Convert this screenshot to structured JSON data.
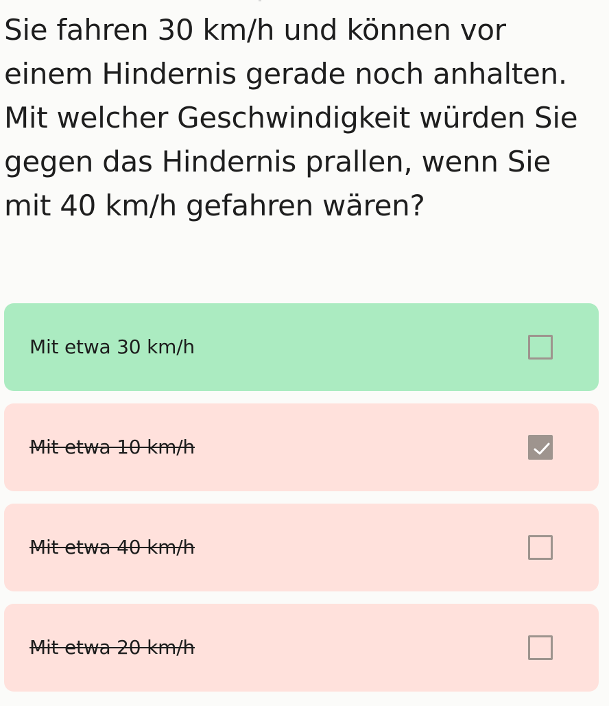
{
  "question": {
    "text": "Sie fahren 30 km/h und können vor einem Hindernis gerade noch anhalten. Mit welcher Geschwindigkeit würden Sie gegen das Hindernis prallen, wenn Sie mit 40 km/h gefahren wären?"
  },
  "answers": [
    {
      "label": "Mit etwa 30 km/h",
      "state": "correct",
      "checked": false
    },
    {
      "label": "Mit etwa 10 km/h",
      "state": "wrong",
      "checked": true
    },
    {
      "label": "Mit etwa 40 km/h",
      "state": "wrong",
      "checked": false
    },
    {
      "label": "Mit etwa 20 km/h",
      "state": "wrong",
      "checked": false
    }
  ],
  "colors": {
    "correct_bg": "#abebc1",
    "wrong_bg": "#ffe1dc",
    "checkbox": "#9e948e"
  },
  "icons": {
    "checked": "check-icon",
    "unchecked": "checkbox-empty-icon"
  }
}
